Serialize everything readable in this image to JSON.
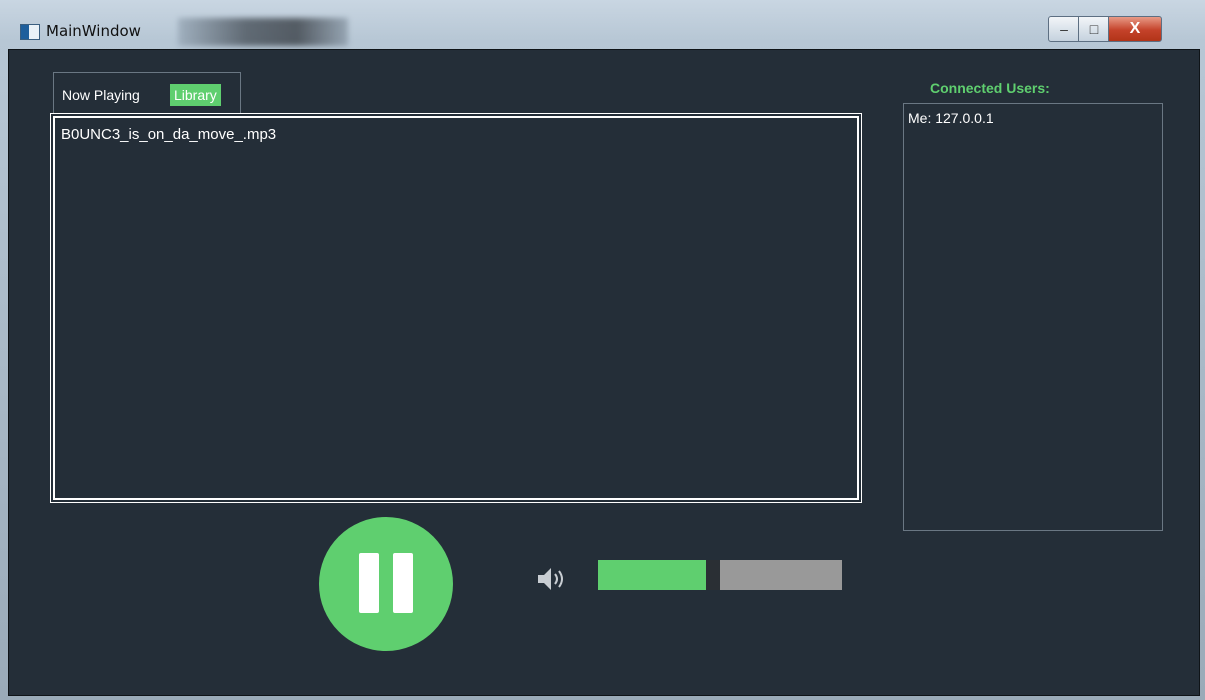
{
  "window": {
    "title": "MainWindow",
    "minimize_glyph": "–",
    "maximize_glyph": "□",
    "close_glyph": "X"
  },
  "tabs": [
    {
      "label": "Now Playing",
      "active": false
    },
    {
      "label": "Library",
      "active": true
    }
  ],
  "library": {
    "items": [
      "B0UNC3_is_on_da_move_.mp3"
    ]
  },
  "users": {
    "label": "Connected Users:",
    "items": [
      "Me: 127.0.0.1"
    ]
  },
  "player": {
    "state": "playing",
    "play_pause_icon": "pause-icon",
    "volume_icon": "speaker-icon",
    "volume": 0.47
  },
  "colors": {
    "accent": "#5fcf6f",
    "background": "#242e38",
    "track": "#999999"
  }
}
